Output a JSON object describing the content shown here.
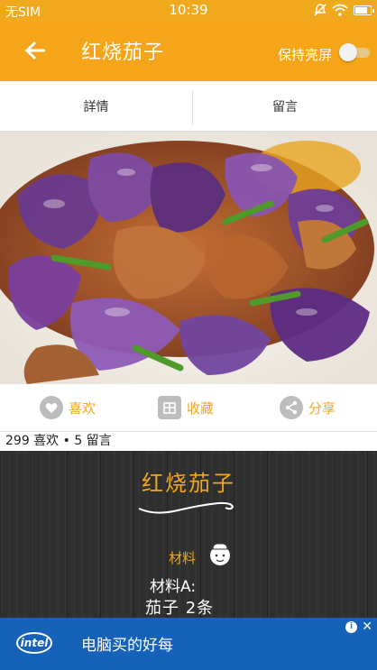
{
  "status_bar": {
    "carrier": "无SIM",
    "time": "10:39"
  },
  "app_bar": {
    "title": "红烧茄子",
    "keep_screen_label": "保持亮屏",
    "keep_screen_on": false
  },
  "tabs": [
    {
      "label": "詳情",
      "active": true
    },
    {
      "label": "留言",
      "active": false
    }
  ],
  "actions": {
    "like": "喜欢",
    "collect": "收藏",
    "share": "分享"
  },
  "stats": "299 喜欢 • 5 留言",
  "recipe": {
    "title": "红烧茄子",
    "materials_label": "材料",
    "materials_a": "材料A:",
    "ingredient_line": "茄子   2条"
  },
  "ad": {
    "logo": "intel",
    "text": "电脑买的好每"
  },
  "colors": {
    "accent": "#f5a519",
    "wood": "#2f2f2f",
    "ad_blue": "#1562b8"
  }
}
